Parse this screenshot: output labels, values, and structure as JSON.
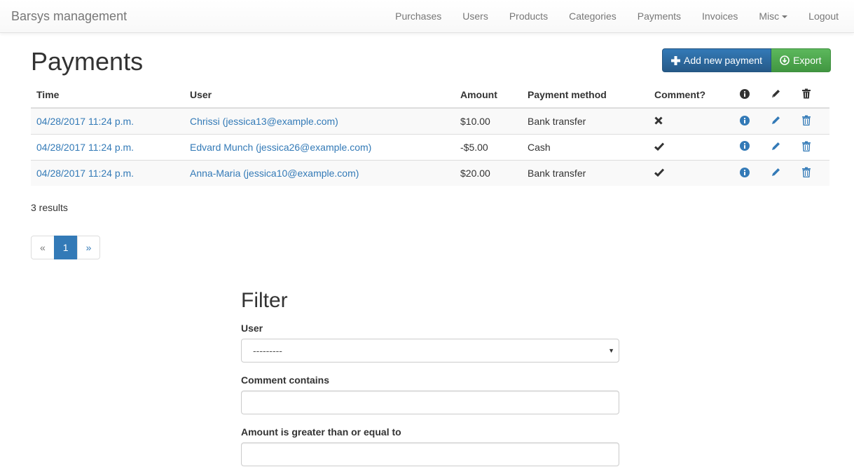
{
  "navbar": {
    "brand": "Barsys management",
    "items": [
      {
        "label": "Purchases"
      },
      {
        "label": "Users"
      },
      {
        "label": "Products"
      },
      {
        "label": "Categories"
      },
      {
        "label": "Payments"
      },
      {
        "label": "Invoices"
      },
      {
        "label": "Misc"
      },
      {
        "label": "Logout"
      }
    ]
  },
  "page": {
    "title": "Payments",
    "add_label": "Add new payment",
    "export_label": "Export"
  },
  "table": {
    "headers": {
      "time": "Time",
      "user": "User",
      "amount": "Amount",
      "method": "Payment method",
      "comment": "Comment?"
    },
    "header_icons": [
      "info-icon",
      "pencil-icon",
      "trash-icon"
    ],
    "rows": [
      {
        "time": "04/28/2017 11:24 p.m.",
        "user": "Chrissi (jessica13@example.com)",
        "amount": "$10.00",
        "method": "Bank transfer",
        "comment": "no"
      },
      {
        "time": "04/28/2017 11:24 p.m.",
        "user": "Edvard Munch (jessica26@example.com)",
        "amount": "-$5.00",
        "method": "Cash",
        "comment": "yes"
      },
      {
        "time": "04/28/2017 11:24 p.m.",
        "user": "Anna-Maria (jessica10@example.com)",
        "amount": "$20.00",
        "method": "Bank transfer",
        "comment": "yes"
      }
    ]
  },
  "results": "3 results",
  "pagination": {
    "prev": "«",
    "current": "1",
    "next": "»"
  },
  "filter": {
    "title": "Filter",
    "user_label": "User",
    "user_selected": "---------",
    "comment_label": "Comment contains",
    "comment_value": "",
    "amount_label": "Amount is greater than or equal to",
    "amount_value": ""
  },
  "colors": {
    "primary": "#337ab7",
    "success": "#5cb85c",
    "link": "#337ab7"
  }
}
